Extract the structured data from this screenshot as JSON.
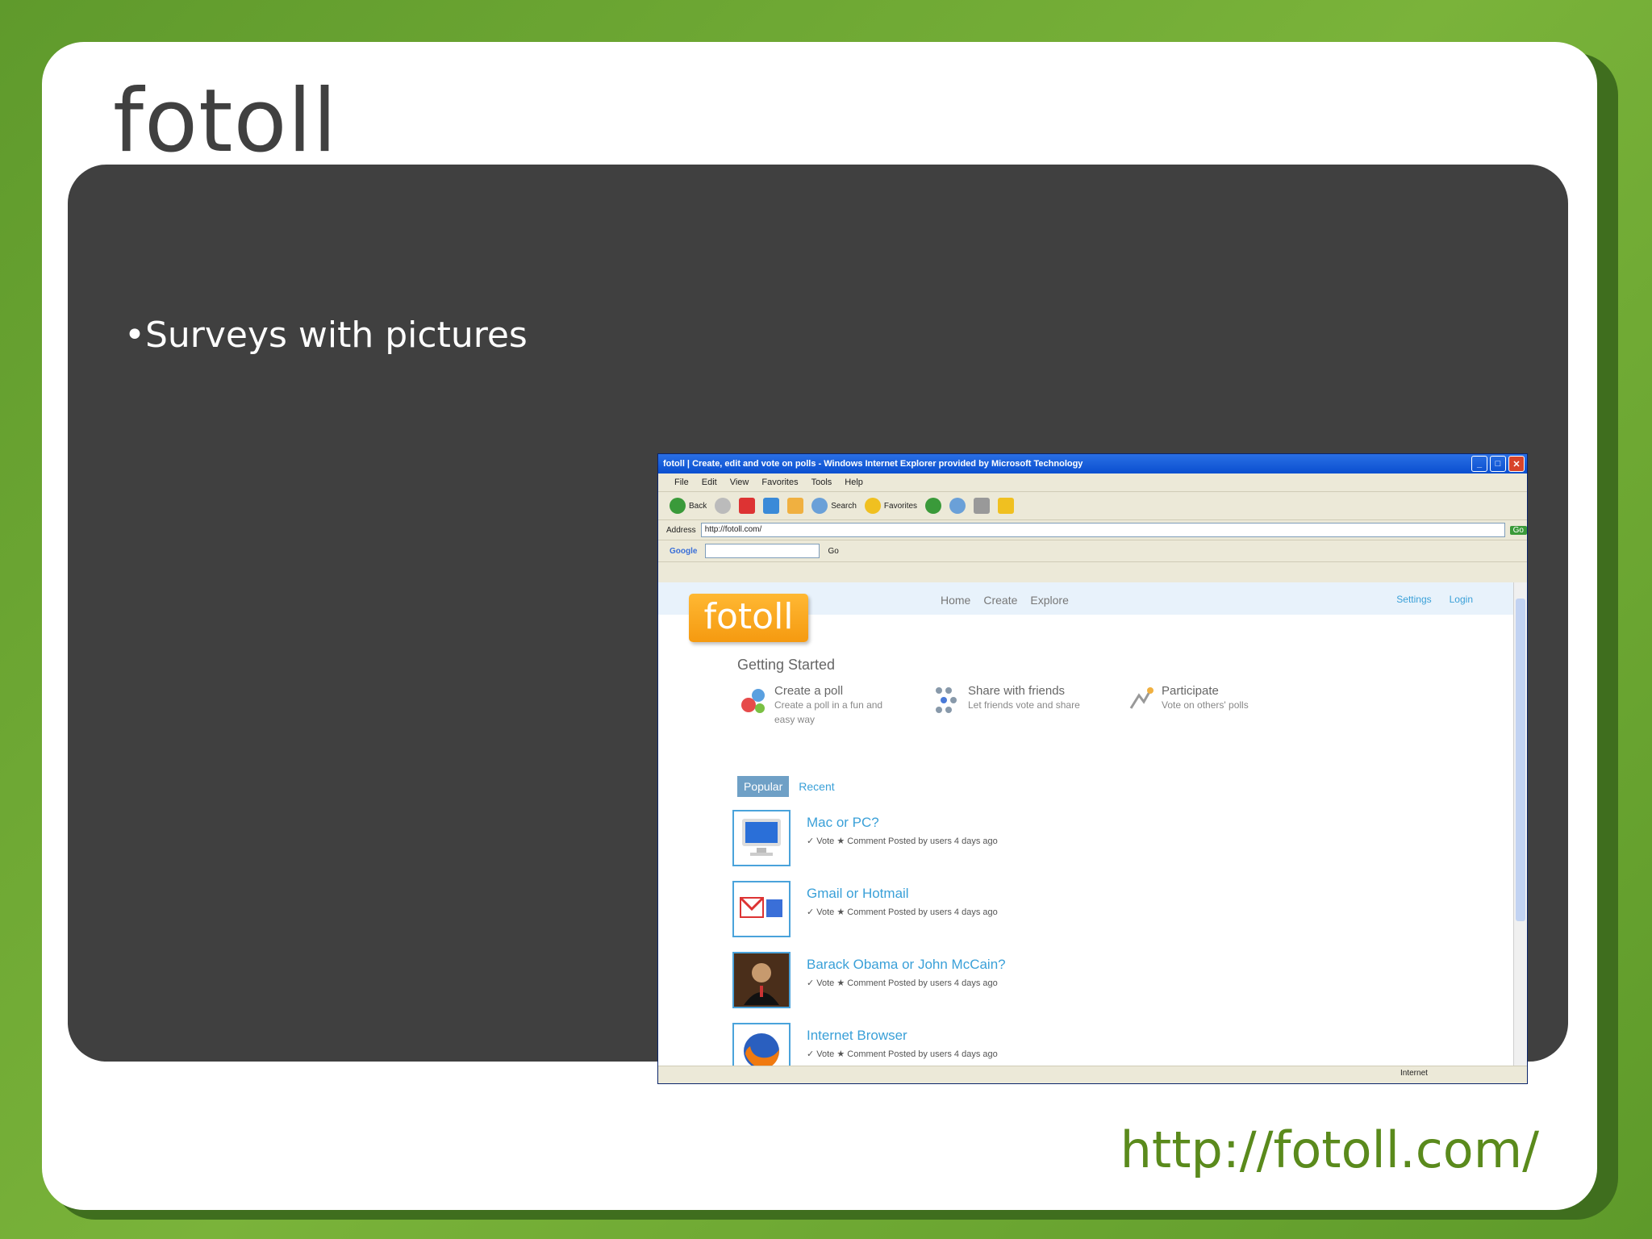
{
  "slide": {
    "title": "fotoll",
    "bullet": "•Surveys with pictures",
    "url": "http://fotoll.com/"
  },
  "browser": {
    "window_title": "fotoll | Create, edit and vote on polls - Windows Internet Explorer provided by Microsoft Technology",
    "menu": [
      "File",
      "Edit",
      "View",
      "Favorites",
      "Tools",
      "Help"
    ],
    "toolbar": {
      "back": "Back",
      "search": "Search",
      "favorites": "Favorites"
    },
    "address": {
      "label": "Address",
      "value": "http://fotoll.com/",
      "go": "Go"
    },
    "google": {
      "label": "Google",
      "go": "Go",
      "search_box": ""
    },
    "status": {
      "text": "",
      "zone": "Internet"
    }
  },
  "site": {
    "logo": "fotoll",
    "nav": [
      "Home",
      "Create",
      "Explore"
    ],
    "topright": [
      "Settings",
      "Login"
    ],
    "getting_started": "Getting Started",
    "items": [
      {
        "title": "Create a poll",
        "desc": "Create a poll in a fun and easy way"
      },
      {
        "title": "Share with friends",
        "desc": "Let friends vote and share"
      },
      {
        "title": "Participate",
        "desc": "Vote on others' polls"
      }
    ],
    "tabs": [
      "Popular",
      "Recent"
    ],
    "polls": [
      {
        "title": "Mac or PC?",
        "meta": "✓ Vote  ★ Comment  Posted by users  4 days ago"
      },
      {
        "title": "Gmail or Hotmail",
        "meta": "✓ Vote  ★ Comment  Posted by users  4 days ago"
      },
      {
        "title": "Barack Obama or John McCain?",
        "meta": "✓ Vote  ★ Comment  Posted by users  4 days ago"
      },
      {
        "title": "Internet Browser",
        "meta": "✓ Vote  ★ Comment  Posted by users  4 days ago"
      }
    ]
  }
}
